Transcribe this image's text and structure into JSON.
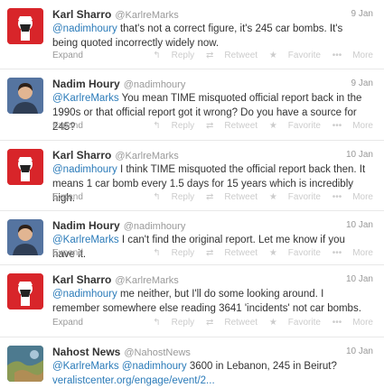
{
  "tweets": [
    {
      "name": "Karl Sharro",
      "handle": "@KarlreMarks",
      "date": "9 Jan",
      "mention": "@nadimhoury",
      "text": " that's not a correct figure, it's 245 car bombs. It's being quoted incorrectly widely now.",
      "expand": "Expand"
    },
    {
      "name": "Nadim Houry",
      "handle": "@nadimhoury",
      "date": "9 Jan",
      "mention": "@KarlreMarks",
      "text": " You mean TIME misquoted official report back in the 1990s or that official report got it wrong? Do you have a source for 245?",
      "expand": "Expand"
    },
    {
      "name": "Karl Sharro",
      "handle": "@KarlreMarks",
      "date": "10 Jan",
      "mention": "@nadimhoury",
      "text": " I think TIME misquoted the official report back then. It means 1 car bomb every 1.5 days for 15 years which is incredibly high.",
      "expand": "Expand"
    },
    {
      "name": "Nadim Houry",
      "handle": "@nadimhoury",
      "date": "10 Jan",
      "mention": "@KarlreMarks",
      "text": " I can't find the original report. Let me know if you have it.",
      "expand": "Expand"
    },
    {
      "name": "Karl Sharro",
      "handle": "@KarlreMarks",
      "date": "10 Jan",
      "mention": "@nadimhoury",
      "text": " me neither, but I'll do some looking around. I remember somewhere else reading 3641 'incidents' not car bombs.",
      "expand": "Expand"
    },
    {
      "name": "Nahost News",
      "handle": "@NahostNews",
      "date": "10 Jan",
      "mention": "@KarlreMarks @nadimhoury",
      "text": " 3600 in Lebanon, 245 in Beirut?",
      "link": "veralistcenter.org/engage/event/2...",
      "expand": ""
    }
  ],
  "actions": {
    "reply": "Reply",
    "retweet": "Retweet",
    "favorite": "Favorite",
    "more": "More"
  },
  "icons": {
    "reply": "reply-arrow-icon",
    "retweet": "retweet-icon",
    "favorite": "star-icon",
    "more": "dots-icon"
  },
  "colors": {
    "mention": "#2b7bb9",
    "karl_avatar": "#d8252a"
  }
}
